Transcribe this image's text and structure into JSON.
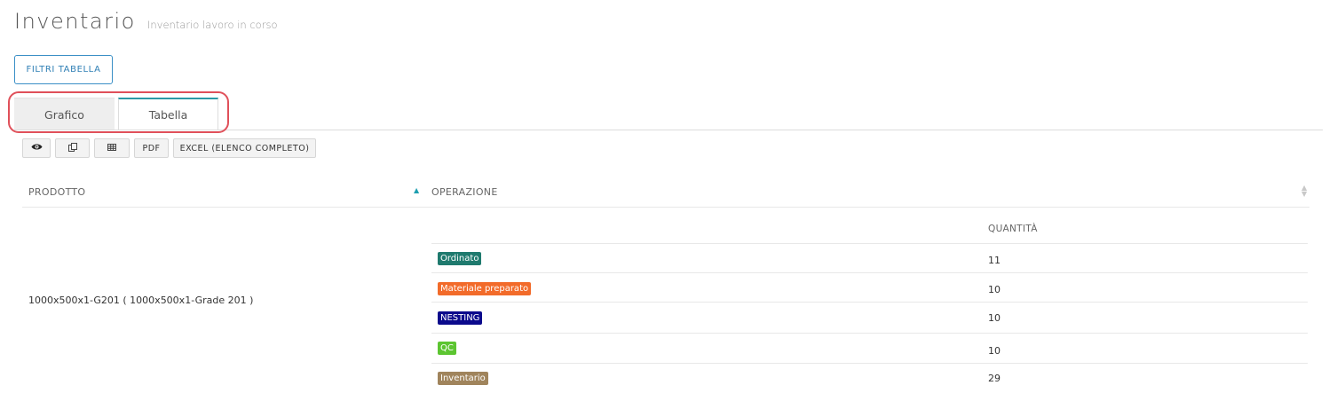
{
  "header": {
    "title": "Inventario",
    "subtitle": "Inventario lavoro in corso"
  },
  "filter_button": "FILTRI TABELLA",
  "tabs": [
    {
      "label": "Grafico",
      "active": false
    },
    {
      "label": "Tabella",
      "active": true
    }
  ],
  "toolbar": {
    "view_icon": "eye-icon",
    "copy_icon": "copy-icon",
    "columns_icon": "table-icon",
    "pdf_label": "PDF",
    "excel_label": "EXCEL (ELENCO COMPLETO)"
  },
  "table": {
    "columns": [
      "PRODOTTO",
      "OPERAZIONE"
    ],
    "quantity_header": "QUANTITÀ",
    "product": "1000x500x1-G201 ( 1000x500x1-Grade 201 )",
    "rows": [
      {
        "operation": "Ordinato",
        "color": "#1f7a6e",
        "quantity": "11"
      },
      {
        "operation": "Materiale preparato",
        "color": "#f26b2a",
        "quantity": "10"
      },
      {
        "operation": "NESTING",
        "color": "#0b0a8c",
        "quantity": "10"
      },
      {
        "operation": "QC",
        "color": "#5cc531",
        "quantity": "10"
      },
      {
        "operation": "Inventario",
        "color": "#a0845c",
        "quantity": "29"
      }
    ]
  }
}
